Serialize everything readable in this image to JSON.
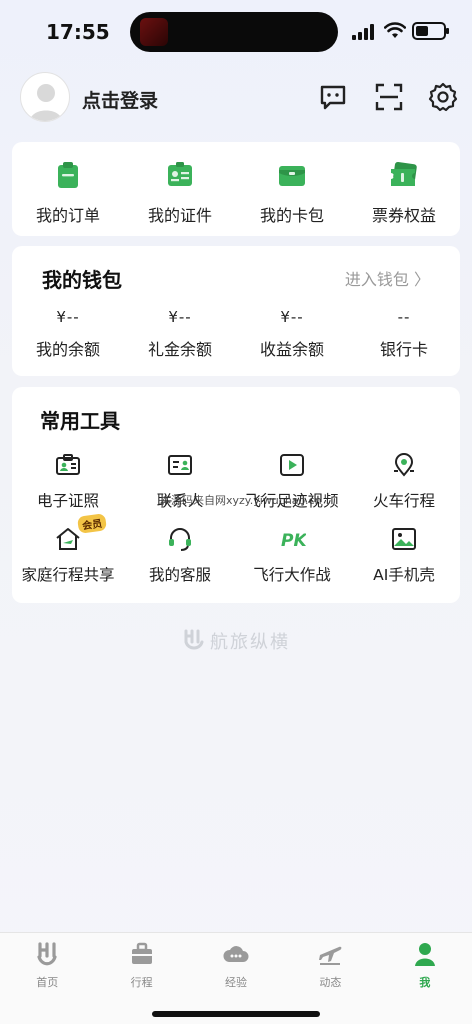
{
  "status_bar": {
    "time": "17:55"
  },
  "profile": {
    "login_text": "点击登录"
  },
  "quick_actions": [
    {
      "label": "我的订单",
      "icon": "clipboard-icon"
    },
    {
      "label": "我的证件",
      "icon": "id-card-icon"
    },
    {
      "label": "我的卡包",
      "icon": "card-wallet-icon"
    },
    {
      "label": "票券权益",
      "icon": "ticket-icon"
    }
  ],
  "wallet": {
    "title": "我的钱包",
    "link": "进入钱包 〉",
    "items": [
      {
        "value": "¥--",
        "label": "我的余额"
      },
      {
        "value": "¥--",
        "label": "礼金余额"
      },
      {
        "value": "¥--",
        "label": "收益余额"
      },
      {
        "value": "--",
        "label": "银行卡"
      }
    ]
  },
  "tools": {
    "title": "常用工具",
    "items": [
      {
        "label": "电子证照",
        "icon": "id-badge-icon"
      },
      {
        "label": "联系人",
        "icon": "contact-card-icon"
      },
      {
        "label": "飞行足迹视频",
        "icon": "video-play-icon"
      },
      {
        "label": "火车行程",
        "icon": "map-pin-icon"
      },
      {
        "label": "家庭行程共享",
        "icon": "home-plane-icon",
        "badge": "会员"
      },
      {
        "label": "我的客服",
        "icon": "headset-icon"
      },
      {
        "label": "飞行大作战",
        "icon": "pk-icon"
      },
      {
        "label": "AI手机壳",
        "icon": "image-icon"
      }
    ]
  },
  "watermark": "本源码来自网xyzy.yiwuchao.cn",
  "brand": "航旅纵横",
  "tabbar": {
    "items": [
      {
        "label": "首页",
        "icon": "home-logo-icon",
        "active": false
      },
      {
        "label": "行程",
        "icon": "briefcase-icon",
        "active": false
      },
      {
        "label": "经验",
        "icon": "cloud-chat-icon",
        "active": false
      },
      {
        "label": "动态",
        "icon": "plane-icon",
        "active": false
      },
      {
        "label": "我",
        "icon": "person-icon",
        "active": true
      }
    ]
  },
  "colors": {
    "accent": "#2fa84f",
    "icon_green": "#3bb25a",
    "background": "#f2f3f8"
  }
}
